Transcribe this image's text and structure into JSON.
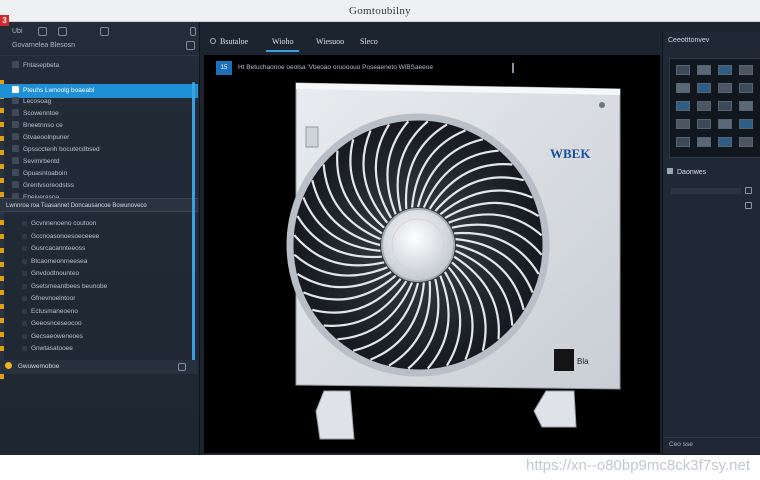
{
  "window": {
    "title": "Gomtoubilny",
    "app_badge": "3"
  },
  "sidebar": {
    "header_line1": "Ubi",
    "header_line2": "Govarnelea Blesosn",
    "items": [
      {
        "label": "Fhtasepbeta"
      },
      {
        "label": "Pteuhs Lwnoolg boaeabl",
        "selected": true
      },
      {
        "label": "Lecosoag"
      },
      {
        "label": "Scowenntoe"
      },
      {
        "label": "Bneetnnso ce"
      },
      {
        "label": "Gtvaeoolnpuner"
      },
      {
        "label": "Gpsscctenh bocutecdbsed"
      },
      {
        "label": "Sevimrbentd"
      },
      {
        "label": "Gpuasntoaboin"
      },
      {
        "label": "Grentvsoreodstss"
      },
      {
        "label": "Ebeiverasoa"
      }
    ],
    "section_header": "Lwnnroa roa Tuasannet Doncausancoe Bowunoveco",
    "sub_items": [
      {
        "label": "Gcvnnenoeno coutoon"
      },
      {
        "label": "Gccnoasonoesoeceeee"
      },
      {
        "label": "Gusrcacannteeoss"
      },
      {
        "label": "Btcaomeonrneesea"
      },
      {
        "label": "Gnvdodtnounteo"
      },
      {
        "label": "Gsetsmeantbees beunobe"
      },
      {
        "label": "Gfnevnoelntoor"
      },
      {
        "label": "Ectusmaneoeno"
      },
      {
        "label": "Geeosnceseocoo"
      },
      {
        "label": "Gecsaeoweneoes"
      },
      {
        "label": "Gnwtasatooee"
      }
    ],
    "footer_label": "Gwuwemoboe"
  },
  "tabs": [
    {
      "label": "Bsutaloe"
    },
    {
      "label": "Wioho",
      "active": true
    },
    {
      "label": "Wiesuoo"
    },
    {
      "label": "Sleco"
    }
  ],
  "viewer": {
    "index_badge": "15",
    "caption": "Ht Betuchaonoe oeolsa 'Vbeoao oruooouo Poseaeneto WiBSaeeoe",
    "unit_brand": "WBEK",
    "unit_badge": "Bla"
  },
  "right_panel": {
    "header": "Ceeotttonvev",
    "sub_header": "Daonwes",
    "footer": "Ceo sse"
  },
  "watermark": "https://xn--o80bp9mc8ck3f7sy.net",
  "colors": {
    "accent": "#1f8fd6",
    "badge_red": "#d6262b",
    "warning_amber": "#f0b020"
  }
}
